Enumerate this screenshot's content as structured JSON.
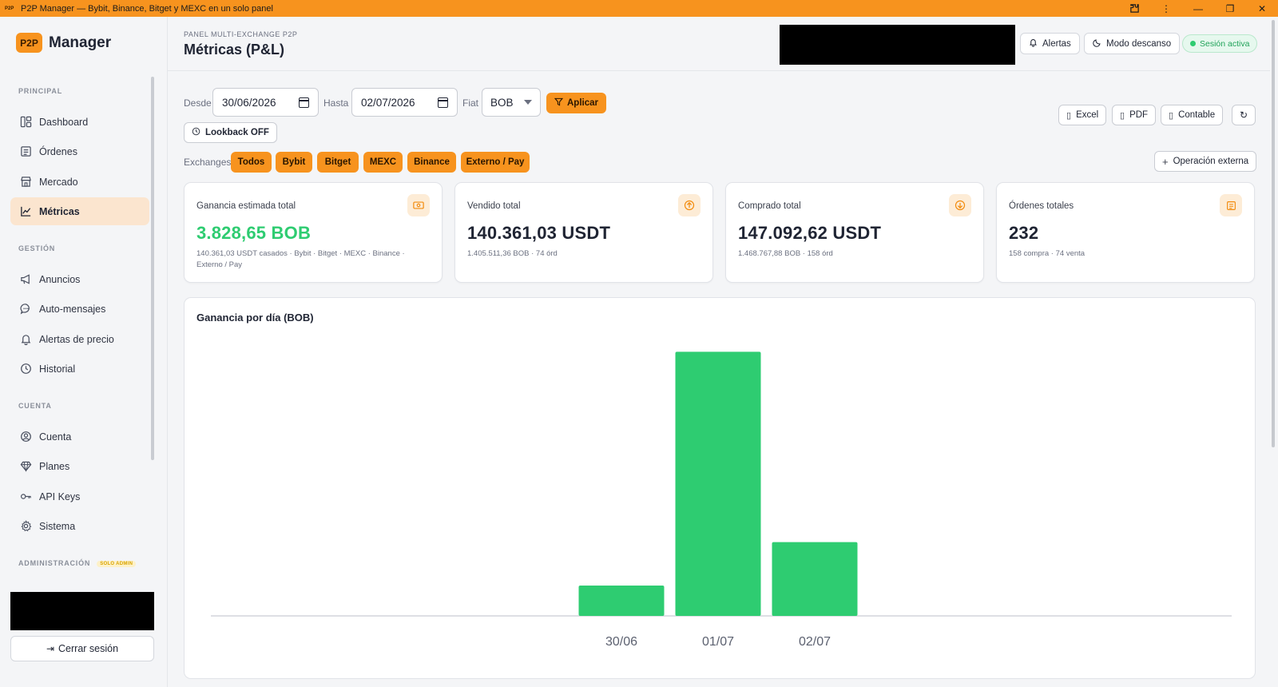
{
  "window": {
    "title": "P2P Manager — Bybit, Binance, Bitget y MEXC en un solo panel",
    "icon_label": "P2P",
    "controls": [
      "extension-icon",
      "more-icon",
      "minimize-icon",
      "maximize-icon",
      "close-icon"
    ]
  },
  "brand": {
    "logo": "P2P",
    "name": "Manager"
  },
  "sidebar": {
    "sections": {
      "principal": "PRINCIPAL",
      "gestion": "GESTIÓN",
      "cuenta": "CUENTA",
      "admin": "ADMINISTRACIÓN",
      "admin_badge": "SOLO ADMIN"
    },
    "items": [
      {
        "label": "Dashboard",
        "icon": "dashboard-icon"
      },
      {
        "label": "Órdenes",
        "icon": "orders-icon"
      },
      {
        "label": "Mercado",
        "icon": "store-icon"
      },
      {
        "label": "Métricas",
        "icon": "chart-line-icon",
        "active": true
      },
      {
        "label": "Anuncios",
        "icon": "megaphone-icon"
      },
      {
        "label": "Auto-mensajes",
        "icon": "chat-icon"
      },
      {
        "label": "Alertas de precio",
        "icon": "bell-icon"
      },
      {
        "label": "Historial",
        "icon": "clock-icon"
      },
      {
        "label": "Cuenta",
        "icon": "user-circle-icon"
      },
      {
        "label": "Planes",
        "icon": "diamond-icon"
      },
      {
        "label": "API Keys",
        "icon": "key-icon"
      },
      {
        "label": "Sistema",
        "icon": "gear-icon"
      }
    ],
    "logout": "Cerrar sesión"
  },
  "header": {
    "kicker": "PANEL MULTI-EXCHANGE P2P",
    "title": "Métricas (P&L)",
    "alerts": "Alertas",
    "rest_mode": "Modo descanso",
    "session": "Sesión activa"
  },
  "filters": {
    "from_label": "Desde",
    "from_value": "30/06/2026",
    "to_label": "Hasta",
    "to_value": "02/07/2026",
    "fiat_label": "Fiat",
    "fiat_value": "BOB",
    "apply": "Aplicar",
    "lookback": "Lookback OFF",
    "exchanges_label": "Exchanges",
    "exchanges": [
      "Todos",
      "Bybit",
      "Bitget",
      "MEXC",
      "Binance",
      "Externo / Pay"
    ]
  },
  "exports": {
    "excel": "Excel",
    "pdf": "PDF",
    "contable": "Contable",
    "external_op": "Operación externa"
  },
  "cards": [
    {
      "label": "Ganancia estimada total",
      "value": "3.828,65 BOB",
      "sub": "140.361,03 USDT casados · Bybit · Bitget · MEXC · Binance · Externo / Pay",
      "icon": "cash-icon",
      "accent": "#2ecc71"
    },
    {
      "label": "Vendido total",
      "value": "140.361,03 USDT",
      "sub": "1.405.511,36 BOB · 74 órd",
      "icon": "arrow-up-circle-icon"
    },
    {
      "label": "Comprado total",
      "value": "147.092,62 USDT",
      "sub": "1.468.767,88 BOB · 158 órd",
      "icon": "arrow-down-circle-icon"
    },
    {
      "label": "Órdenes totales",
      "value": "232",
      "sub": "158 compra · 74 venta",
      "icon": "list-icon"
    }
  ],
  "chart_data": {
    "type": "bar",
    "title": "Ganancia por día (BOB)",
    "categories": [
      "30/06",
      "01/07",
      "02/07"
    ],
    "values": [
      350,
      3040,
      850
    ],
    "ylim": [
      0,
      3200
    ],
    "grid": false,
    "bar_color": "#2ecc71"
  },
  "colors": {
    "accent": "#f7931e",
    "positive": "#2ecc71",
    "active_nav_bg": "#fbe5cf"
  }
}
